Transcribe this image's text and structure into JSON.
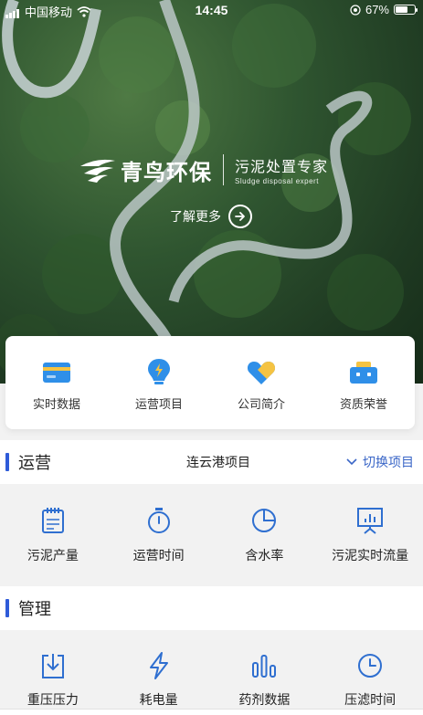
{
  "status_bar": {
    "carrier": "中国移动",
    "time": "14:45",
    "battery": "67%",
    "battery_level": 0.67
  },
  "hero": {
    "brand_name": "青鸟环保",
    "slogan_cn": "污泥处置专家",
    "slogan_en": "Sludge disposal expert",
    "learn_more": "了解更多"
  },
  "quick_nav": [
    {
      "label": "实时数据",
      "icon": "card-icon"
    },
    {
      "label": "运营项目",
      "icon": "lightbulb-icon"
    },
    {
      "label": "公司简介",
      "icon": "heart-icon"
    },
    {
      "label": "资质荣誉",
      "icon": "briefcase-icon"
    }
  ],
  "operations": {
    "title": "运营",
    "project": "连云港项目",
    "switch_label": "切换项目",
    "items": [
      {
        "label": "污泥产量",
        "icon": "notepad-icon"
      },
      {
        "label": "运营时间",
        "icon": "stopwatch-icon"
      },
      {
        "label": "含水率",
        "icon": "pie-chart-icon"
      },
      {
        "label": "污泥实时流量",
        "icon": "presentation-chart-icon"
      }
    ]
  },
  "management": {
    "title": "管理",
    "items": [
      {
        "label": "重压压力",
        "icon": "download-box-icon"
      },
      {
        "label": "耗电量",
        "icon": "lightning-icon"
      },
      {
        "label": "药剂数据",
        "icon": "bar-chart-icon"
      },
      {
        "label": "压滤时间",
        "icon": "clock-icon"
      }
    ]
  },
  "colors": {
    "accent": "#2e5bd8",
    "link": "#3a66c7",
    "icon_blue": "#2f6fd0",
    "icon_yellow": "#f5c342"
  }
}
